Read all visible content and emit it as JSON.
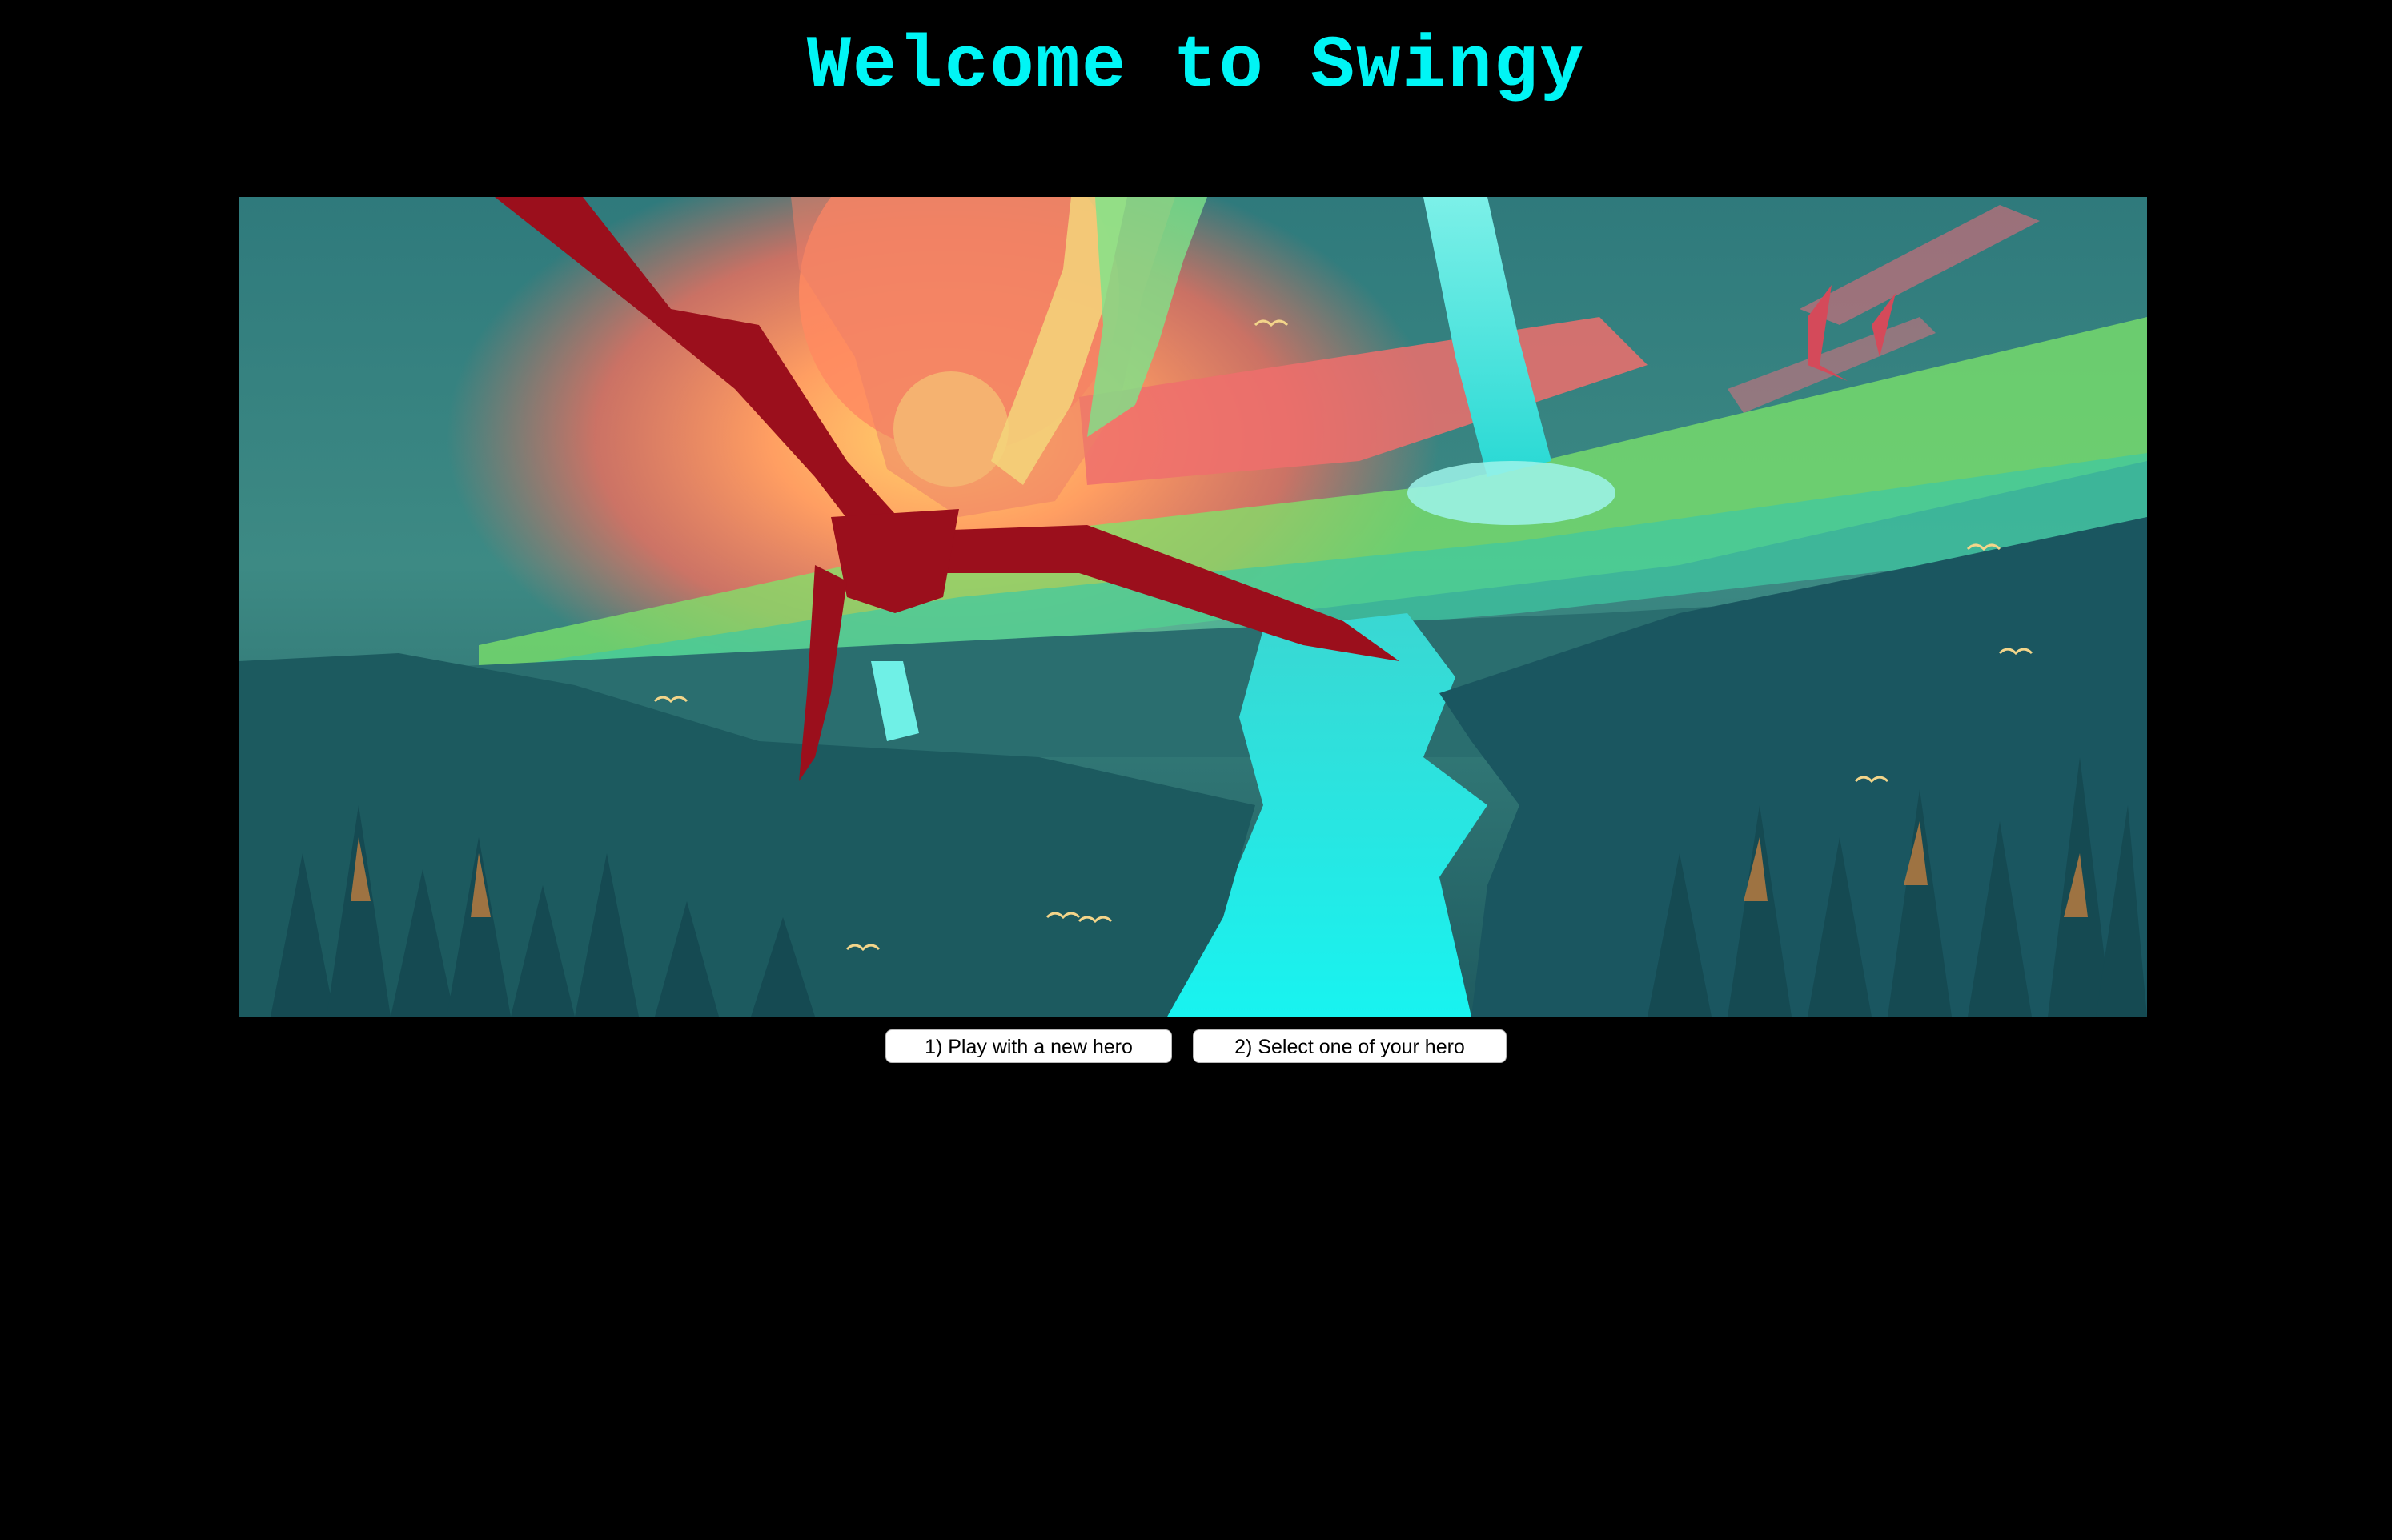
{
  "title": "Welcome to Swingy",
  "buttons": {
    "new_hero": "1) Play with a new hero",
    "select_hero": "2) Select one of your hero"
  },
  "colors": {
    "background": "#000000",
    "title": "#00f5f5",
    "button_bg": "#ffffff"
  }
}
